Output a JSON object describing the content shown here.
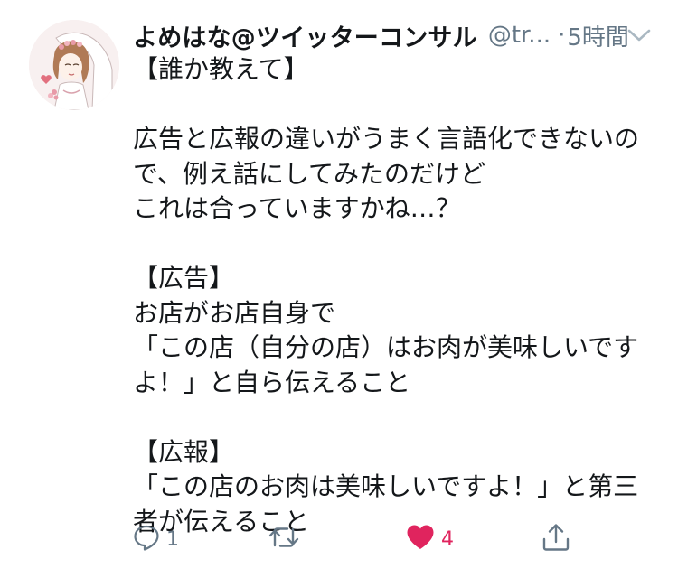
{
  "tweet": {
    "display_name": "よめはな@ツイッターコンサル",
    "handle": "@tr...",
    "separator": "·",
    "timestamp": "5時間",
    "body_lines": [
      "【誰か教えて】",
      "",
      "広告と広報の違いがうまく言語化できないの",
      "で、例え話にしてみたのだけど",
      "これは合っていますかね…？",
      "",
      "【広告】",
      "お店がお店自身で",
      "「この店（自分の店）はお肉が美味しいです",
      "よ！」と自ら伝えること",
      "",
      "【広報】",
      "「この店のお肉は美味しいですよ！」と第三",
      "者が伝えること"
    ]
  },
  "actions": {
    "reply": {
      "icon": "reply-icon",
      "count": "1"
    },
    "retweet": {
      "icon": "retweet-icon",
      "count": ""
    },
    "like": {
      "icon": "heart-icon",
      "count": "4",
      "liked": true,
      "color": "#e0245e"
    },
    "share": {
      "icon": "share-icon",
      "count": ""
    }
  },
  "colors": {
    "text": "#14171a",
    "secondary": "#657786",
    "like": "#e0245e"
  }
}
